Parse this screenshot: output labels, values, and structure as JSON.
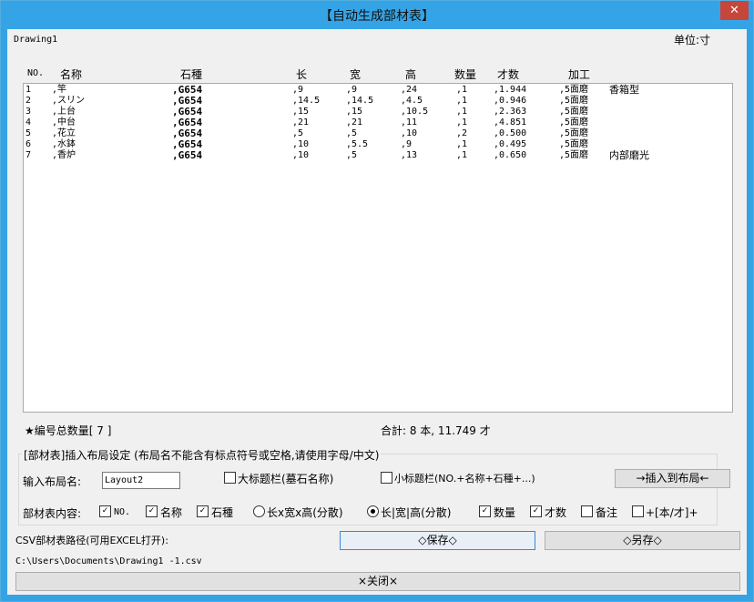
{
  "window": {
    "title": "【自动生成部材表】",
    "close_glyph": "✕"
  },
  "drawing_name": "Drawing1",
  "unit_label": "单位:寸",
  "columns": [
    "NO.",
    "名称",
    "石種",
    "长",
    "宽",
    "高",
    "数量",
    "才数",
    "加工"
  ],
  "rows": [
    {
      "no": "1",
      "name": ",竿",
      "stone": ",G654",
      "l": ",9",
      "w": ",9",
      "h": ",24",
      "qty": ",1",
      "cai": ",1.944",
      "proc": ",5面磨",
      "note": "香箱型"
    },
    {
      "no": "2",
      "name": ",スリン",
      "stone": ",G654",
      "l": ",14.5",
      "w": ",14.5",
      "h": ",4.5",
      "qty": ",1",
      "cai": ",0.946",
      "proc": ",5面磨",
      "note": ""
    },
    {
      "no": "3",
      "name": ",上台",
      "stone": ",G654",
      "l": ",15",
      "w": ",15",
      "h": ",10.5",
      "qty": ",1",
      "cai": ",2.363",
      "proc": ",5面磨",
      "note": ""
    },
    {
      "no": "4",
      "name": ",中台",
      "stone": ",G654",
      "l": ",21",
      "w": ",21",
      "h": ",11",
      "qty": ",1",
      "cai": ",4.851",
      "proc": ",5面磨",
      "note": ""
    },
    {
      "no": "5",
      "name": ",花立",
      "stone": ",G654",
      "l": ",5",
      "w": ",5",
      "h": ",10",
      "qty": ",2",
      "cai": ",0.500",
      "proc": ",5面磨",
      "note": ""
    },
    {
      "no": "6",
      "name": ",水鉢",
      "stone": ",G654",
      "l": ",10",
      "w": ",5.5",
      "h": ",9",
      "qty": ",1",
      "cai": ",0.495",
      "proc": ",5面磨",
      "note": ""
    },
    {
      "no": "7",
      "name": ",香炉",
      "stone": ",G654",
      "l": ",10",
      "w": ",5",
      "h": ",13",
      "qty": ",1",
      "cai": ",0.650",
      "proc": ",5面磨",
      "note": "内部磨光"
    }
  ],
  "summary": {
    "count_label": "★编号总数量[ 7 ]",
    "total_label": "合計: 8 本, 11.749 才"
  },
  "layout_group": {
    "title": "[部材表]插入布局设定 (布局名不能含有标点符号或空格,请使用字母/中文)",
    "name_label": "输入布局名:",
    "name_value": "Layout2",
    "big_title_label": "大标题栏(墓石名称)",
    "small_title_label": "小标题栏(NO.+名称+石種+...)",
    "insert_button": "→插入到布局←",
    "content_label": "部材表内容:",
    "opt_no": "NO.",
    "opt_name": "名称",
    "opt_stone": "石種",
    "radio_a": "长x宽x高(分散)",
    "radio_b": "长|宽|高(分散)",
    "opt_qty": "数量",
    "opt_cai": "才数",
    "opt_note": "备注",
    "opt_unit": "+[本/才]+"
  },
  "csv": {
    "label": "CSV部材表路径(可用EXCEL打开):",
    "save_button": "◇保存◇",
    "save_as_button": "◇另存◇",
    "path": "C:\\Users\\Documents\\Drawing1 -1.csv"
  },
  "close_button": "×关闭×"
}
